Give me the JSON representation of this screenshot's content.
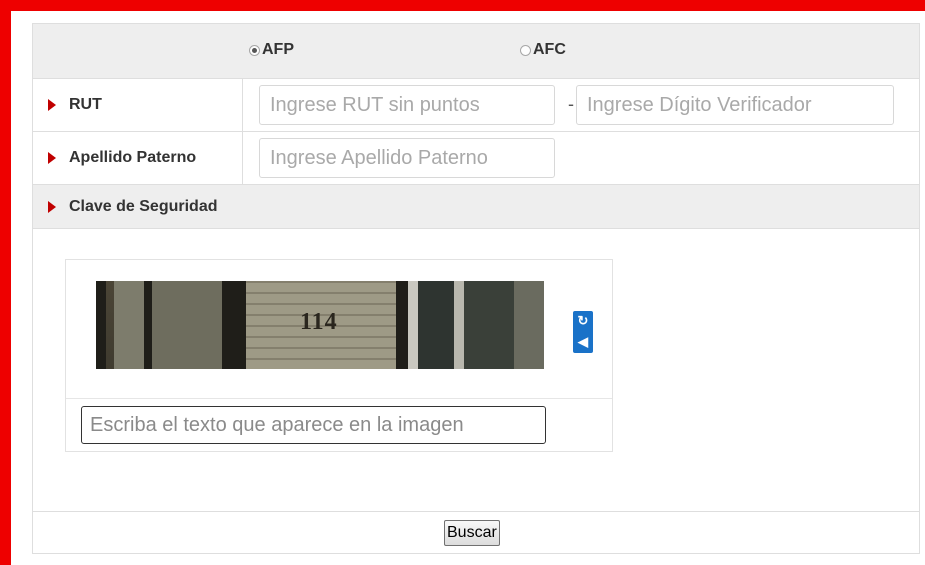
{
  "radios": [
    {
      "label": "AFP",
      "checked": true
    },
    {
      "label": "AFC",
      "checked": false
    }
  ],
  "rut": {
    "label": "RUT",
    "number_placeholder": "Ingrese RUT sin puntos",
    "separator": "-",
    "dv_placeholder": "Ingrese Dígito Verificador"
  },
  "apellido": {
    "label": "Apellido Paterno",
    "placeholder": "Ingrese Apellido Paterno"
  },
  "clave": {
    "label": "Clave de Seguridad",
    "captcha_text": "114",
    "refresh_icon": "refresh-icon",
    "audio_icon": "audio-icon",
    "input_placeholder": "Escriba el texto que aparece en la imagen"
  },
  "submit": {
    "label": "Buscar"
  },
  "colors": {
    "frame": "#ee0000",
    "arrow": "#c00000",
    "captcha_icons": "#1a72c8"
  }
}
